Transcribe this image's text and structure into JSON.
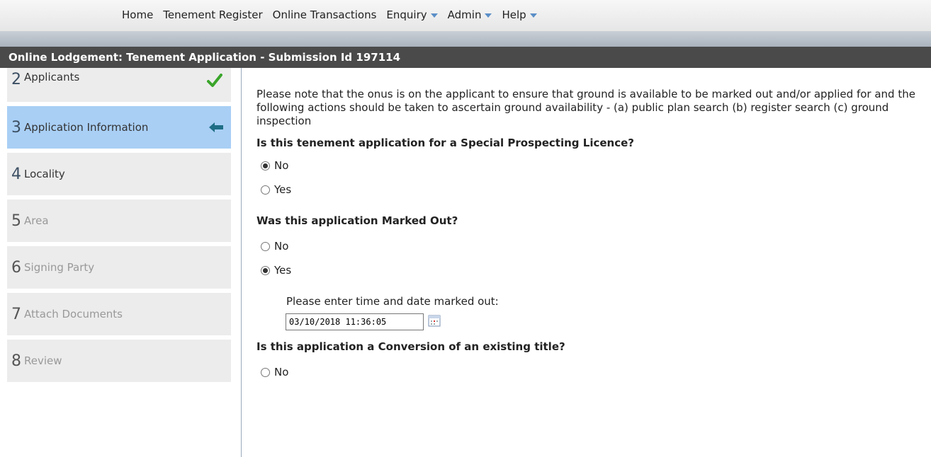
{
  "nav": {
    "items": [
      {
        "label": "Home",
        "dropdown": false
      },
      {
        "label": "Tenement Register",
        "dropdown": false
      },
      {
        "label": "Online Transactions",
        "dropdown": false
      },
      {
        "label": "Enquiry",
        "dropdown": true
      },
      {
        "label": "Admin",
        "dropdown": true
      },
      {
        "label": "Help",
        "dropdown": true
      }
    ]
  },
  "title": "Online Lodgement: Tenement Application - Submission Id 197114",
  "sidebar": {
    "steps": [
      {
        "num": "2",
        "label": "Applicants",
        "state": "complete"
      },
      {
        "num": "3",
        "label": "Application Information",
        "state": "current"
      },
      {
        "num": "4",
        "label": "Locality",
        "state": "enabled"
      },
      {
        "num": "5",
        "label": "Area",
        "state": "disabled"
      },
      {
        "num": "6",
        "label": "Signing Party",
        "state": "disabled"
      },
      {
        "num": "7",
        "label": "Attach Documents",
        "state": "disabled"
      },
      {
        "num": "8",
        "label": "Review",
        "state": "disabled"
      }
    ]
  },
  "main": {
    "notice": "Please note that the onus is on the applicant to ensure that ground is available to be marked out and/or applied for and the following actions should be taken to ascertain ground availability - (a) public plan search (b) register search (c) ground inspection",
    "q1": {
      "text": "Is this tenement application for a Special Prospecting Licence?",
      "no": "No",
      "yes": "Yes",
      "selected": "No"
    },
    "q2": {
      "text": "Was this application Marked Out?",
      "no": "No",
      "yes": "Yes",
      "selected": "Yes"
    },
    "marked_out_label": "Please enter time and date marked out:",
    "marked_out_value": "03/10/2018 11:36:05",
    "q3": {
      "text": "Is this application a Conversion of an existing title?",
      "no": "No"
    }
  },
  "colors": {
    "titlebar": "#4a4a4a",
    "current_step": "#a9cff5",
    "check": "#3aa52a",
    "arrow": "#1f6e86"
  }
}
